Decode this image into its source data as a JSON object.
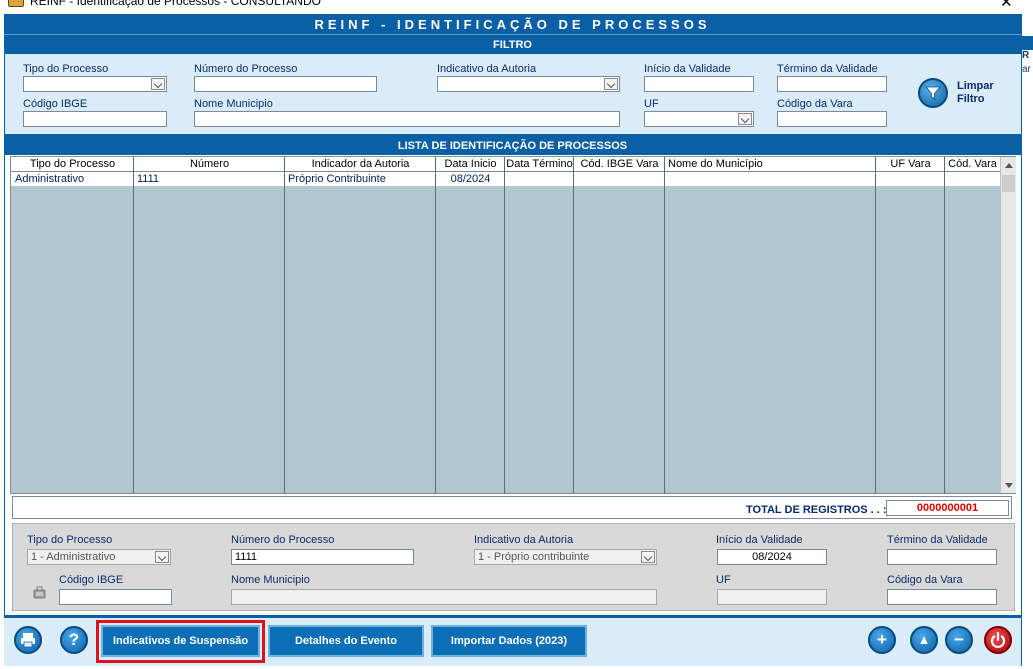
{
  "window": {
    "title": "REINF - Identificação de Processos  -  CONSULTANDO",
    "close_glyph": "✕",
    "side_text_1": "R",
    "side_text_2": "ar"
  },
  "header": {
    "title": "REINF - IDENTIFICAÇÃO DE PROCESSOS"
  },
  "filter": {
    "section_title": "FILTRO",
    "tipo_processo": {
      "label": "Tipo do Processo",
      "value": ""
    },
    "numero_processo": {
      "label": "Número do Processo",
      "value": ""
    },
    "indicativo_autoria": {
      "label": "Indicativo da Autoria",
      "value": ""
    },
    "inicio_validade": {
      "label": "Início da Validade",
      "value": ""
    },
    "termino_validade": {
      "label": "Término da Validade",
      "value": ""
    },
    "codigo_ibge": {
      "label": "Código IBGE",
      "value": ""
    },
    "nome_municipio": {
      "label": "Nome Municipio",
      "value": ""
    },
    "uf": {
      "label": "UF",
      "value": ""
    },
    "codigo_vara": {
      "label": "Código da Vara",
      "value": ""
    },
    "limpar_label_1": "Limpar",
    "limpar_label_2": "Filtro"
  },
  "list": {
    "section_title": "LISTA DE IDENTIFICAÇÃO DE PROCESSOS",
    "columns": [
      "Tipo do Processo",
      "Número",
      "Indicador da Autoria",
      "Data Inicio",
      "Data Término",
      "Cód. IBGE Vara",
      "Nome do Município",
      "UF Vara",
      "Cód. Vara"
    ],
    "rows": [
      [
        "Administrativo",
        "1111",
        "Próprio Contribuinte",
        "08/2024",
        "",
        "",
        "",
        "",
        ""
      ]
    ],
    "total_label": "TOTAL DE REGISTROS . . :",
    "total_value": "0000000001"
  },
  "detail": {
    "tipo_processo": {
      "label": "Tipo do Processo",
      "value": "1 - Administrativo"
    },
    "numero_processo": {
      "label": "Número do Processo",
      "value": "1111"
    },
    "indicativo_autoria": {
      "label": "Indicativo da Autoria",
      "value": "1 - Próprio contribuinte"
    },
    "inicio_validade": {
      "label": "Início da Validade",
      "value": "08/2024"
    },
    "termino_validade": {
      "label": "Término da Validade",
      "value": ""
    },
    "codigo_ibge": {
      "label": "Código IBGE",
      "value": ""
    },
    "nome_municipio": {
      "label": "Nome Municipio",
      "value": ""
    },
    "uf": {
      "label": "UF",
      "value": ""
    },
    "codigo_vara": {
      "label": "Código da Vara",
      "value": ""
    }
  },
  "toolbar": {
    "print_icon": "print-icon",
    "help_label": "?",
    "suspensao_label": "Indicativos de Suspensão",
    "detalhes_label": "Detalhes do Evento",
    "importar_label": "Importar Dados (2023)",
    "add_label": "+",
    "up_label": "▲",
    "remove_label": "−",
    "power_icon": "power-icon"
  },
  "colors": {
    "primary": "#0b5fa5",
    "panel": "#d9ecf8",
    "grid": "#b2c6d0",
    "highlight": "#e0111b",
    "total": "#e00000"
  }
}
